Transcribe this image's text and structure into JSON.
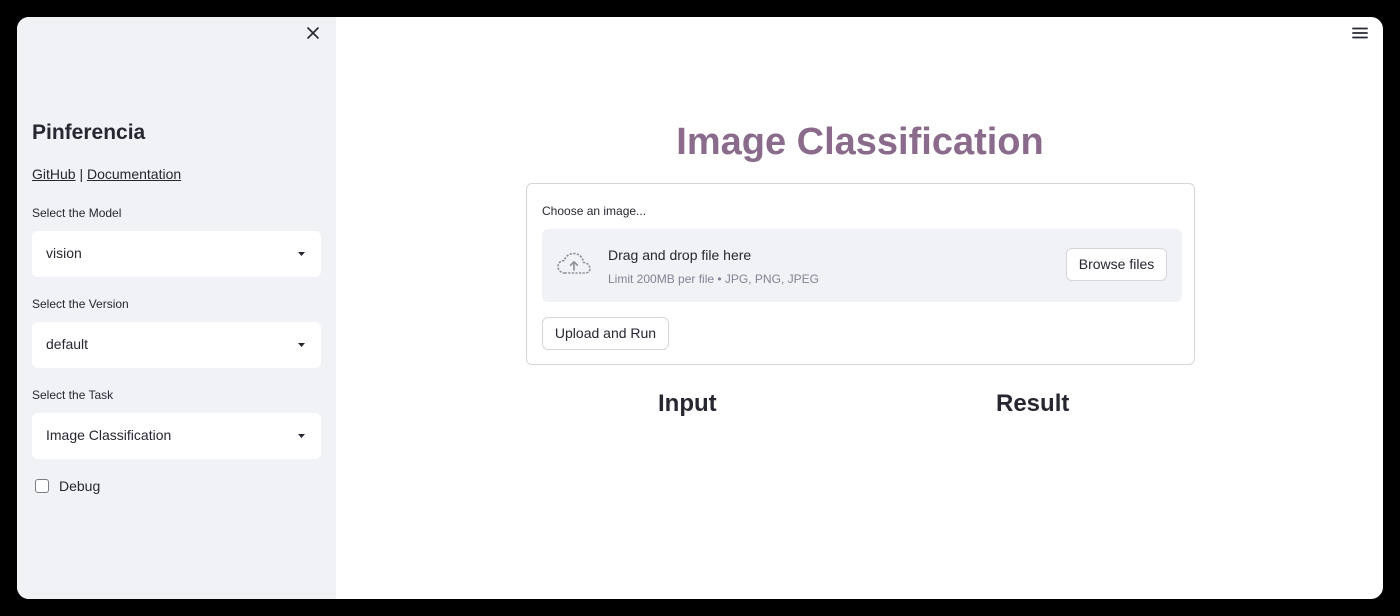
{
  "sidebar": {
    "title": "Pinferencia",
    "links": [
      {
        "label": "GitHub"
      },
      {
        "label": "Documentation"
      }
    ],
    "link_separator": " | ",
    "model": {
      "label": "Select the Model",
      "value": "vision"
    },
    "version": {
      "label": "Select the Version",
      "value": "default"
    },
    "task": {
      "label": "Select the Task",
      "value": "Image Classification"
    },
    "debug": {
      "label": "Debug",
      "checked": false
    }
  },
  "main": {
    "title": "Image Classification",
    "title_color": "#8a6b8c",
    "uploader": {
      "label": "Choose an image...",
      "drop_title": "Drag and drop file here",
      "limit_text": "Limit 200MB per file • JPG, PNG, JPEG",
      "browse_label": "Browse files"
    },
    "run_button_label": "Upload and Run",
    "input_heading": "Input",
    "result_heading": "Result"
  },
  "icons": {
    "close": "close-icon",
    "menu": "hamburger-menu-icon",
    "caret": "chevron-down-icon",
    "upload": "cloud-upload-icon"
  }
}
